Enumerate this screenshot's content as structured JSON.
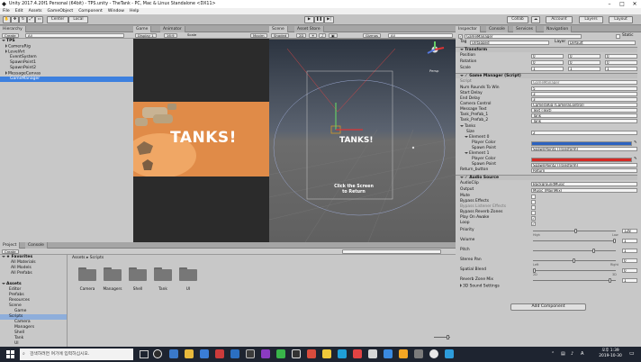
{
  "window": {
    "title": "Unity 2017.4.20f1 Personal (64bit) - TPS.unity - TheTank - PC, Mac & Linux Standalone <DX11>"
  },
  "menu": [
    "File",
    "Edit",
    "Assets",
    "GameObject",
    "Component",
    "Window",
    "Help"
  ],
  "toolbar": {
    "pivot": "Center",
    "space": "Local",
    "collab": "Collab",
    "account": "Account",
    "layers": "Layers",
    "layout": "Layout"
  },
  "hierarchy": {
    "tab": "Hierarchy",
    "create": "Create",
    "search_placeholder": "All",
    "scene": "TPS",
    "items": [
      "CameraRig",
      "LevelArt",
      "EventSystem",
      "SpawnPoint1",
      "SpawnPoint2",
      "MessageCanvas",
      "GameManager"
    ]
  },
  "game": {
    "tab": "Game",
    "tab2": "Animator",
    "display": "Display 1",
    "aspect": "16:9",
    "scale": "Scale",
    "maximize": "Maxim",
    "title": "TANKS!"
  },
  "scene": {
    "tab": "Scene",
    "tab2": "Asset Store",
    "shaded": "Shaded",
    "mode": "2D",
    "gizmos": "Gizmos",
    "search_placeholder": "All",
    "title": "TANKS!",
    "message_line1": "Click the Screen",
    "message_line2": "to Return",
    "persp": "Persp"
  },
  "inspector": {
    "tab": "Inspector",
    "tab2": "Console",
    "tab3": "Services",
    "tab4": "Navigation",
    "object_name": "GameManager",
    "static": "Static",
    "tag_label": "Tag",
    "tag": "Untagged",
    "layer_label": "Layer",
    "layer": "Default",
    "transform_title": "Transform",
    "position": "Position",
    "rotation": "Rotation",
    "scale": "Scale",
    "pos": [
      "0",
      "0",
      "0"
    ],
    "rot": [
      "0",
      "0",
      "0"
    ],
    "scl": [
      "1",
      "1",
      "1"
    ],
    "script_title": "Game Manager (Script)",
    "script_label": "Script",
    "script_value": "GameManager",
    "fields": [
      {
        "label": "Num Rounds To Win",
        "value": "5"
      },
      {
        "label": "Start Delay",
        "value": "3"
      },
      {
        "label": "End Delay",
        "value": "3"
      },
      {
        "label": "Camera Control",
        "value": "CameraRig (CameraControl)"
      },
      {
        "label": "Message Text",
        "value": "Text (Text)"
      },
      {
        "label": "Tank_Prefab_1",
        "value": "Tank"
      },
      {
        "label": "Tank_Prefab_2",
        "value": "Tank"
      }
    ],
    "tanks_label": "Tanks",
    "size_label": "Size",
    "size_value": "2",
    "element0": "Element 0",
    "element1": "Element 1",
    "player_color": "Player Color",
    "spawn_point": "Spawn Point",
    "spawn1": "SpawnPoint1 (Transform)",
    "spawn2": "SpawnPoint2 (Transform)",
    "color0": "#2c62c0",
    "color1": "#d42a24",
    "return_label": "Return_button",
    "return_value": "Return",
    "audio_title": "Audio Source",
    "audio_clip_label": "AudioClip",
    "audio_clip": "BackgroundMusic",
    "output_label": "Output",
    "output": "Music (MainMix)",
    "checks": [
      {
        "label": "Mute",
        "checked": ""
      },
      {
        "label": "Bypass Effects",
        "checked": ""
      },
      {
        "label": "Bypass Listener Effects",
        "checked": ""
      },
      {
        "label": "Bypass Reverb Zones",
        "checked": ""
      },
      {
        "label": "Play On Awake",
        "checked": "✓"
      },
      {
        "label": "Loop",
        "checked": "✓"
      }
    ],
    "priority_label": "Priority",
    "priority": "128",
    "high": "High",
    "low": "Low",
    "volume_label": "Volume",
    "volume": "1",
    "pitch_label": "Pitch",
    "pitch": "1",
    "stereo_label": "Stereo Pan",
    "stereo": "0",
    "left": "Left",
    "right": "Right",
    "spatial_label": "Spatial Blend",
    "spatial": "0",
    "two_d": "2D",
    "three_d": "3D",
    "reverb_label": "Reverb Zone Mix",
    "reverb": "1",
    "sound3d": "3D Sound Settings",
    "add_component": "Add Component"
  },
  "project": {
    "tab": "Project",
    "tab2": "Console",
    "create": "Create",
    "favorites": "Favorites",
    "fav_items": [
      "All Materials",
      "All Models",
      "All Prefabs"
    ],
    "assets": "Assets",
    "tree": [
      "Editor",
      "Prefabs",
      "Resources",
      "Scene",
      "Game",
      "Scripts",
      "Camera",
      "Managers",
      "Shell",
      "Tank",
      "UI"
    ],
    "breadcrumb_root": "Assets",
    "breadcrumb_sep": "▸",
    "breadcrumb_leaf": "Scripts",
    "folders": [
      "Camera",
      "Managers",
      "Shell",
      "Tank",
      "UI"
    ]
  },
  "taskbar": {
    "search_placeholder": "검색하려면 여기에 입력하십시오.",
    "time": "오후 1:39",
    "date": "2019-10-30",
    "lang": "A"
  }
}
